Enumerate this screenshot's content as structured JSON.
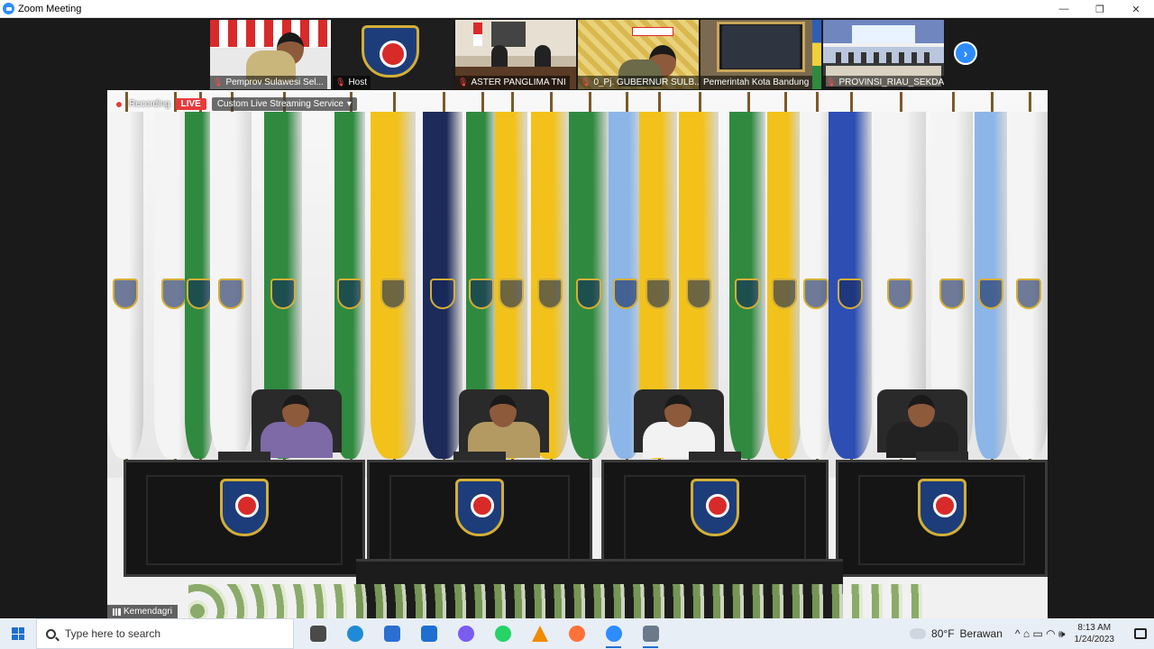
{
  "window": {
    "title": "Zoom Meeting",
    "controls": [
      "—",
      "❐",
      "✕"
    ]
  },
  "thumbnails": [
    {
      "label": "Pemprov Sulawesi Sel..."
    },
    {
      "label": "Host"
    },
    {
      "label": "ASTER PANGLIMA TNI"
    },
    {
      "label": "0_Pj. GUBERNUR SULB..."
    },
    {
      "label": "Pemerintah Kota Bandung"
    },
    {
      "label": "PROVINSI_RIAU_SEKDA"
    }
  ],
  "next_button": "›",
  "stage": {
    "recording_text": "Recording",
    "live_label": "LIVE",
    "stream_label": "Custom Live Streaming Service",
    "stream_caret": "▾",
    "speaker_name": "Kemendagri"
  },
  "taskbar": {
    "search_placeholder": "Type here to search",
    "apps": [
      {
        "name": "task-view-icon",
        "color": "#4a4a4a"
      },
      {
        "name": "edge-icon",
        "color": "#1f8bd6"
      },
      {
        "name": "store-icon",
        "color": "#2b6fd1"
      },
      {
        "name": "mail-icon",
        "color": "#1f6fd1"
      },
      {
        "name": "copilot-icon",
        "color": "#7b5cf0"
      },
      {
        "name": "whatsapp-icon",
        "color": "#25d366"
      },
      {
        "name": "vlc-icon",
        "color": "#f08a00"
      },
      {
        "name": "firefox-icon",
        "color": "#ff7139"
      },
      {
        "name": "zoom-icon",
        "color": "#2d8cff"
      },
      {
        "name": "meeting-app-icon",
        "color": "#6a7a8a"
      }
    ],
    "weather": {
      "temp": "80°F",
      "condition": "Berawan"
    },
    "tray_icons": "^  ⌂  ▭  ◠  🕪",
    "time": "8:13 AM",
    "date": "1/24/2023"
  }
}
